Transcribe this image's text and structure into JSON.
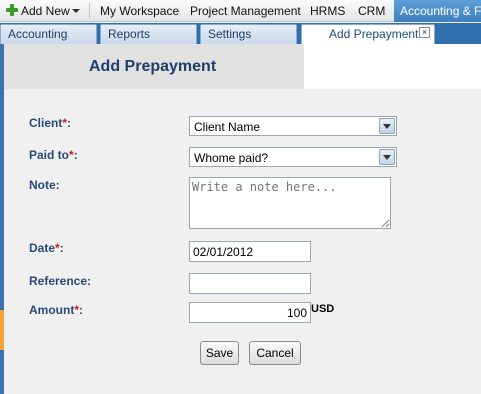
{
  "topnav": {
    "add_new": "Add New",
    "items": [
      "My Workspace",
      "Project Management",
      "HRMS",
      "CRM"
    ],
    "active": "Accounting & Fin"
  },
  "subtabs": {
    "items": [
      "Accounting",
      "Reports",
      "Settings"
    ],
    "active": "Add Prepayment"
  },
  "page": {
    "title": "Add Prepayment"
  },
  "form": {
    "client_label": "Client",
    "paid_to_label": "Paid to",
    "note_label": "Note:",
    "date_label": "Date",
    "reference_label": "Reference:",
    "amount_label": "Amount",
    "required_mark": "*",
    "colon": ":",
    "client_value": "Client Name",
    "paid_to_value": "Whome paid?",
    "note_placeholder": "Write a note here...",
    "date_value": "02/01/2012",
    "reference_value": "",
    "amount_value": "100",
    "currency": "USD",
    "save_label": "Save",
    "cancel_label": "Cancel"
  },
  "colors": {
    "accent_blue": "#3f7fbf",
    "label_blue": "#2a4a76",
    "required_red": "#d01c1c"
  }
}
